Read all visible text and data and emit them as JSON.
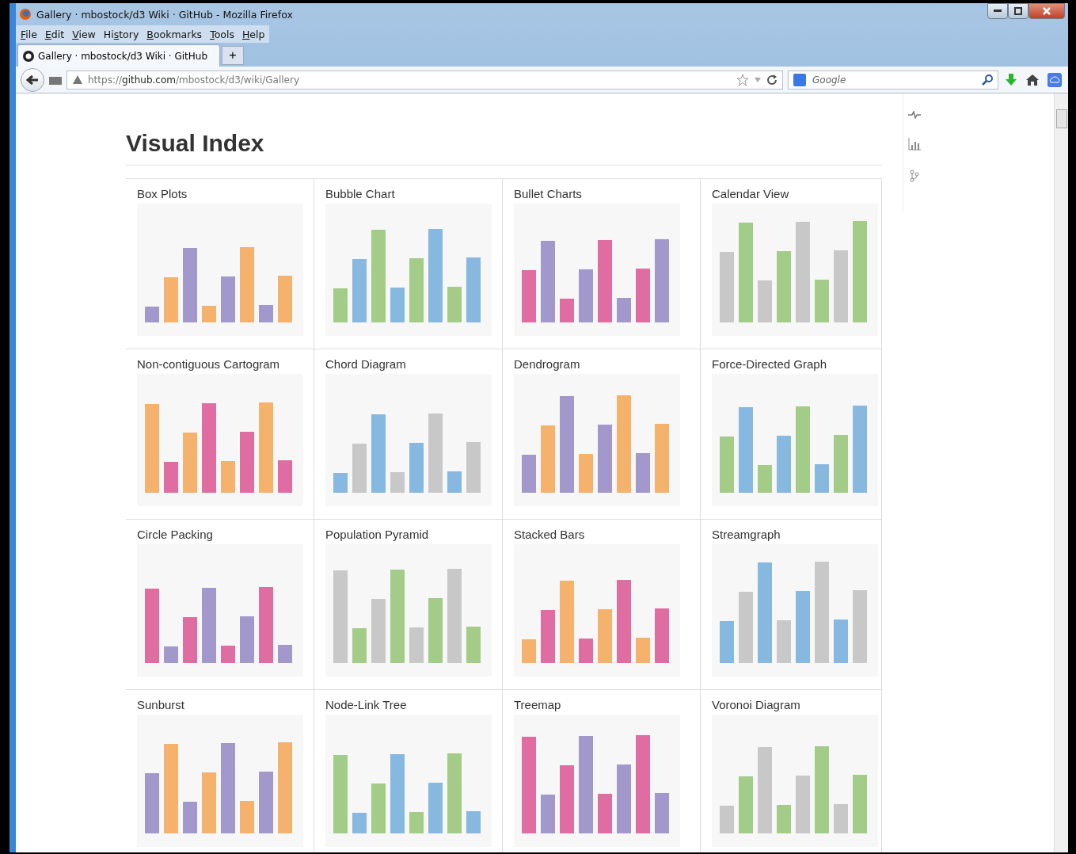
{
  "window": {
    "title": "Gallery · mbostock/d3 Wiki · GitHub - Mozilla Firefox"
  },
  "menu": [
    {
      "label": "File"
    },
    {
      "label": "Edit"
    },
    {
      "label": "View"
    },
    {
      "label": "History"
    },
    {
      "label": "Bookmarks"
    },
    {
      "label": "Tools"
    },
    {
      "label": "Help"
    }
  ],
  "tabs": [
    {
      "label": "Gallery · mbostock/d3 Wiki · GitHub",
      "selected": true
    }
  ],
  "new_tab": "+",
  "address": {
    "scheme": "https://",
    "host": "github.com",
    "path": "/mbostock/d3/wiki/Gallery"
  },
  "search": {
    "placeholder": "Google"
  },
  "page": {
    "heading": "Visual Index",
    "cards": [
      {
        "title": "Box Plots"
      },
      {
        "title": "Bubble Chart"
      },
      {
        "title": "Bullet Charts"
      },
      {
        "title": "Calendar View"
      },
      {
        "title": "Non-contiguous Cartogram"
      },
      {
        "title": "Chord Diagram"
      },
      {
        "title": "Dendrogram"
      },
      {
        "title": "Force-Directed Graph"
      },
      {
        "title": "Circle Packing"
      },
      {
        "title": "Population Pyramid"
      },
      {
        "title": "Stacked Bars"
      },
      {
        "title": "Streamgraph"
      },
      {
        "title": "Sunburst"
      },
      {
        "title": "Node-Link Tree"
      },
      {
        "title": "Treemap"
      },
      {
        "title": "Voronoi Diagram"
      }
    ]
  }
}
